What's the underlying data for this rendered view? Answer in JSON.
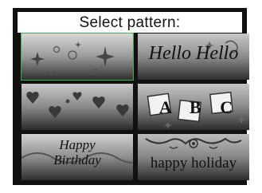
{
  "dialog": {
    "title": "Select pattern:"
  },
  "patterns": [
    {
      "id": "sparkles",
      "label": "",
      "selected": true
    },
    {
      "id": "hello",
      "label": "Hello Hello",
      "selected": false
    },
    {
      "id": "hearts",
      "label": "",
      "selected": false
    },
    {
      "id": "abc-blocks",
      "label": "A B C",
      "selected": false
    },
    {
      "id": "happy-birthday",
      "label": "Happy Birthday",
      "selected": false
    },
    {
      "id": "happy-holiday",
      "label": "happy holiday",
      "selected": false
    }
  ],
  "colors": {
    "frame": "#111111",
    "selection": "#36b34a"
  }
}
